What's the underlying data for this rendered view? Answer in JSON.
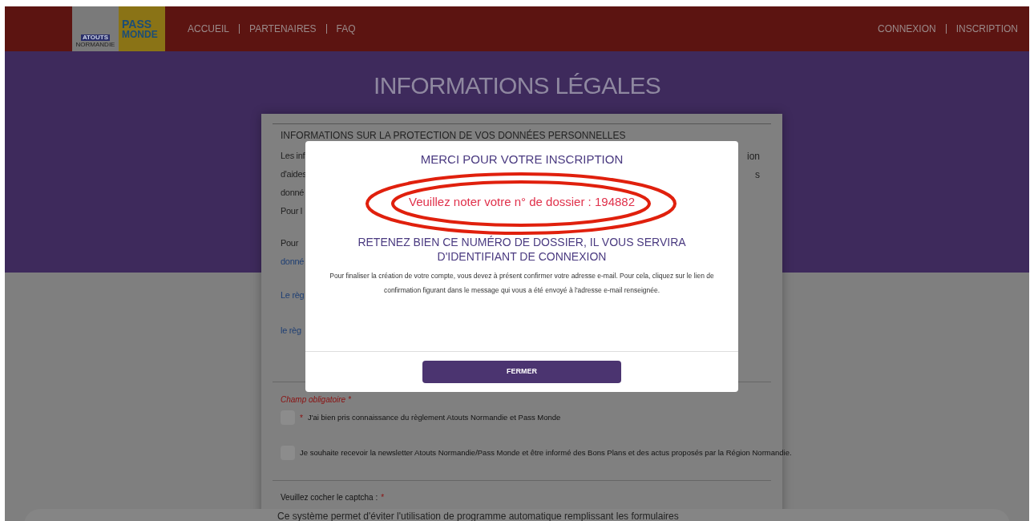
{
  "header": {
    "logos": [
      "ATOUTS",
      "NORMANDIE",
      "PASS",
      "MONDE"
    ],
    "nav_left": [
      "ACCUEIL",
      "PARTENAIRES",
      "FAQ"
    ],
    "nav_right": [
      "CONNEXION",
      "INSCRIPTION"
    ]
  },
  "page_title": "INFORMATIONS LÉGALES",
  "card": {
    "section_title": "INFORMATIONS SUR LA PROTECTION DE VOS DONNÉES PERSONNELLES",
    "fragments": [
      {
        "left": "Les inf",
        "right": "ion",
        "kind": "text"
      },
      {
        "left": "d'aides",
        "right": "s",
        "kind": "text"
      },
      {
        "left": "donné",
        "kind": "text"
      },
      {
        "left": "Pour l",
        "kind": "text"
      },
      {
        "left": "Pour",
        "kind": "gap"
      },
      {
        "left": "donné",
        "kind": "link"
      },
      {
        "left": "Le règ",
        "kind": "link_gap"
      },
      {
        "left": "le règ",
        "kind": "link_gap2"
      }
    ],
    "required_note": "Champ obligatoire *",
    "checkboxes": [
      {
        "marker": "*",
        "label": "J'ai bien pris connaissance du règlement Atouts Normandie et Pass Monde",
        "checked": false
      },
      {
        "label": "Je souhaite recevoir la newsletter Atouts Normandie/Pass Monde et être informé des Bons Plans et des actus proposés par la Région Normandie.",
        "checked": false
      }
    ],
    "captcha_label": "Veuillez cocher le captcha :",
    "captcha_marker": "*",
    "captcha_text": "Ce système permet d'éviter l'utilisation de programme automatique remplissant les formulaires"
  },
  "modal": {
    "title": "MERCI POUR VOTRE INSCRIPTION",
    "dossier": "Veuillez noter votre n° de dossier : 194882",
    "notice": "RETENEZ BIEN CE NUMÉRO DE DOSSIER, IL VOUS SERVIRA D'IDENTIFIANT DE CONNEXION",
    "body": "Pour finaliser la création de votre compte, vous devez à présent confirmer votre adresse e-mail. Pour cela, cliquez sur le lien de confirmation figurant dans le message qui vous a été envoyé à l'adresse e-mail renseignée.",
    "button": "FERMER"
  }
}
